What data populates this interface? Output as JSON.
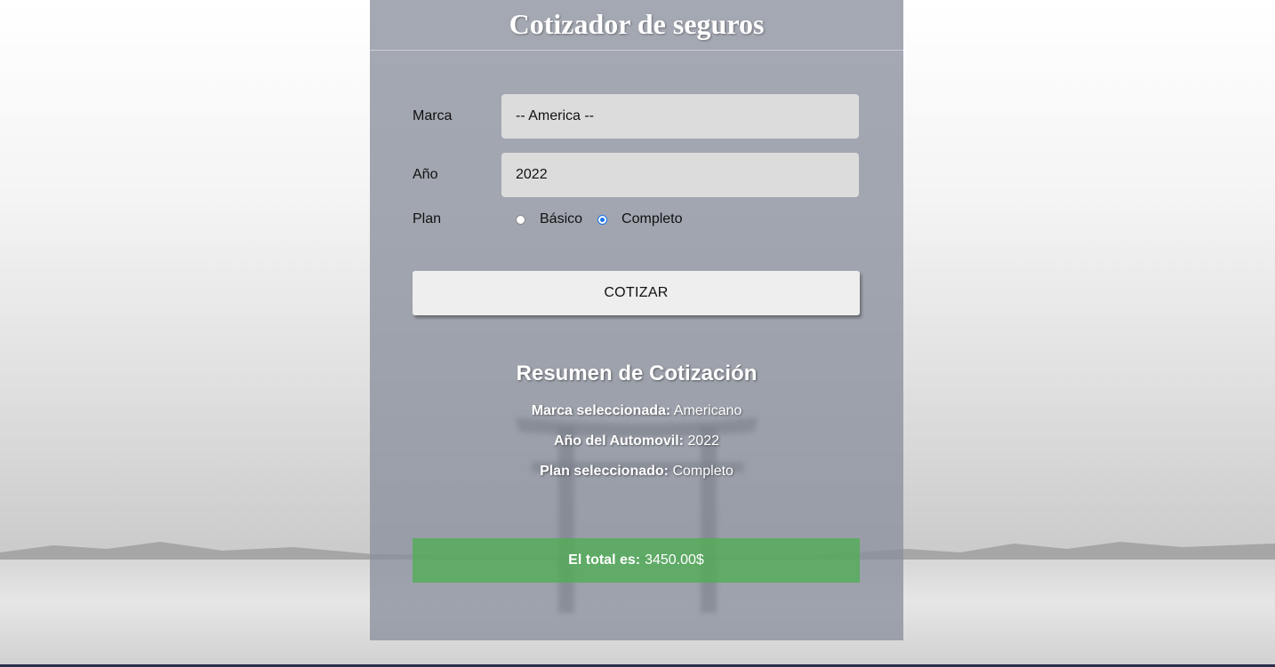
{
  "header": {
    "title": "Cotizador de seguros"
  },
  "form": {
    "brand": {
      "label": "Marca",
      "value": "-- America --"
    },
    "year": {
      "label": "Año",
      "value": "2022"
    },
    "plan": {
      "label": "Plan",
      "options": [
        {
          "label": "Básico",
          "checked": false
        },
        {
          "label": "Completo",
          "checked": true
        }
      ]
    },
    "submit_label": "COTIZAR"
  },
  "summary": {
    "title": "Resumen de Cotización",
    "brand": {
      "label": "Marca seleccionada:",
      "value": "Americano"
    },
    "year": {
      "label": "Año del Automovil:",
      "value": "2022"
    },
    "plan": {
      "label": "Plan seleccionado:",
      "value": "Completo"
    }
  },
  "total": {
    "label": "El total es:",
    "value": "3450.00$"
  },
  "colors": {
    "card_overlay": "#8a909c",
    "total_bg": "#4caf50",
    "field_bg": "#dcdcdc",
    "button_bg": "#eeeeee",
    "radio_accent": "#1a73e8"
  }
}
